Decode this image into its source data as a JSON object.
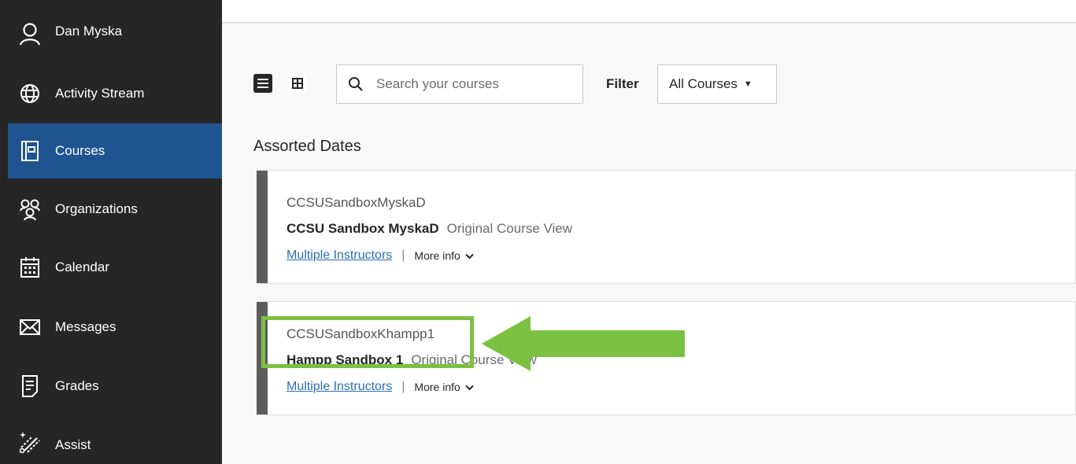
{
  "sidebar": {
    "items": [
      {
        "label": "Dan Myska",
        "icon": "user-icon"
      },
      {
        "label": "Activity Stream",
        "icon": "globe-icon"
      },
      {
        "label": "Courses",
        "icon": "courses-icon",
        "active": true
      },
      {
        "label": "Organizations",
        "icon": "organizations-icon"
      },
      {
        "label": "Calendar",
        "icon": "calendar-icon"
      },
      {
        "label": "Messages",
        "icon": "envelope-icon"
      },
      {
        "label": "Grades",
        "icon": "grades-icon"
      },
      {
        "label": "Assist",
        "icon": "assist-icon"
      }
    ]
  },
  "toolbar": {
    "search_placeholder": "Search your courses",
    "filter_label": "Filter",
    "filter_value": "All Courses"
  },
  "section_title": "Assorted Dates",
  "courses": [
    {
      "id": "CCSUSandboxMyskaD",
      "name": "CCSU Sandbox MyskaD",
      "view": "Original Course View",
      "instructors": "Multiple Instructors",
      "separator": "|",
      "more_info": "More info"
    },
    {
      "id": "CCSUSandboxKhampp1",
      "name": "Hampp Sandbox 1",
      "view": "Original Course View",
      "instructors": "Multiple Instructors",
      "separator": "|",
      "more_info": "More info"
    }
  ],
  "colors": {
    "sidebar_bg": "#262626",
    "active_bg": "#1f5490",
    "highlight": "#7ac142",
    "link": "#2a6fb0"
  }
}
